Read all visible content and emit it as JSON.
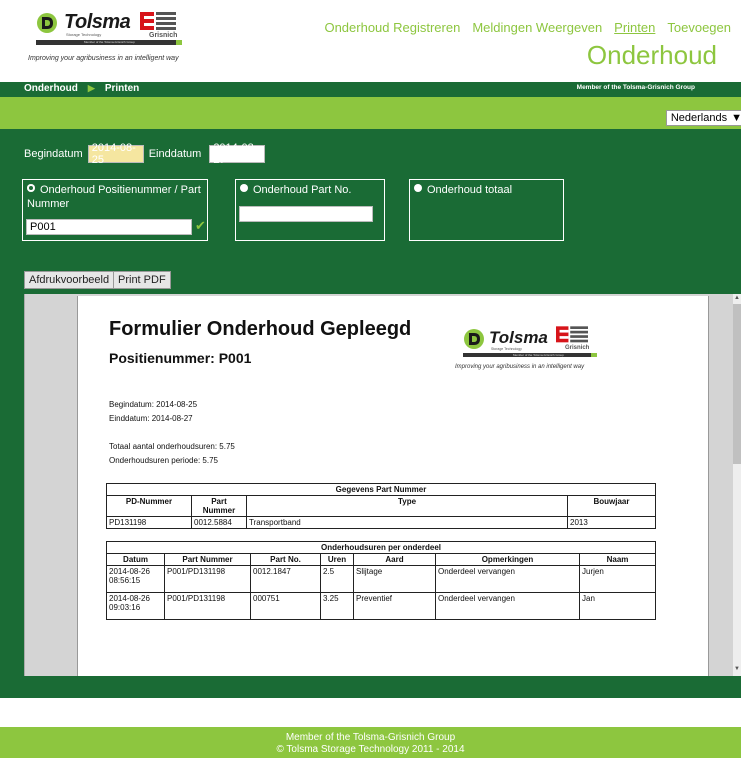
{
  "brand": {
    "name": "Tolsma",
    "sub": "Storage Technology",
    "partner": "Grisnich",
    "bar_text": "Member of the Tolsma-Grisnich Group",
    "tagline": "Improving your agribusiness in an intelligent way"
  },
  "nav": {
    "items": [
      {
        "label": "Onderhoud Registreren"
      },
      {
        "label": "Meldingen Weergeven"
      },
      {
        "label": "Printen"
      },
      {
        "label": "Toevoegen"
      }
    ]
  },
  "page_title": "Onderhoud",
  "breadcrumb": {
    "root": "Onderhoud",
    "current": "Printen"
  },
  "member_text": "Member of the Tolsma-Grisnich Group",
  "language": "Nederlands",
  "form": {
    "begin_label": "Begindatum",
    "begin_value": "2014-08-25",
    "end_label": "Einddatum",
    "end_value": "2014-08-27",
    "opt1_label": "Onderhoud Positienummer / Part Nummer",
    "opt1_value": "P001",
    "opt2_label": "Onderhoud Part No.",
    "opt3_label": "Onderhoud totaal",
    "btn_preview": "Afdrukvoorbeeld",
    "btn_pdf": "Print PDF"
  },
  "report": {
    "title": "Formulier Onderhoud Gepleegd",
    "subtitle": "Positienummer: P001",
    "begin": "Begindatum: 2014-08-25",
    "end": "Einddatum: 2014-08-27",
    "total": "Totaal aantal onderhoudsuren: 5.75",
    "period": "Onderhoudsuren periode: 5.75",
    "t1_caption": "Gegevens Part Nummer",
    "t1_headers": [
      "PD-Nummer",
      "Part Nummer",
      "Type",
      "Bouwjaar"
    ],
    "t1_row": [
      "PD131198",
      "0012.5884",
      "Transportband",
      "2013"
    ],
    "t2_caption": "Onderhoudsuren per onderdeel",
    "t2_headers": [
      "Datum",
      "Part Nummer",
      "Part No.",
      "Uren",
      "Aard",
      "Opmerkingen",
      "Naam"
    ],
    "t2_rows": [
      [
        "2014-08-26 08:56:15",
        "P001/PD131198",
        "0012.1847",
        "2.5",
        "Slijtage",
        "Onderdeel vervangen",
        "Jurjen"
      ],
      [
        "2014-08-26 09:03:16",
        "P001/PD131198",
        "000751",
        "3.25",
        "Preventief",
        "Onderdeel vervangen",
        "Jan"
      ]
    ]
  },
  "footer": {
    "line1": "Member of the Tolsma-Grisnich Group",
    "line2": "© Tolsma Storage Technology 2011 - 2014"
  },
  "colors": {
    "dark_green": "#1a6b35",
    "light_green": "#8dc63f",
    "date_highlight": "#f5e6a0"
  }
}
